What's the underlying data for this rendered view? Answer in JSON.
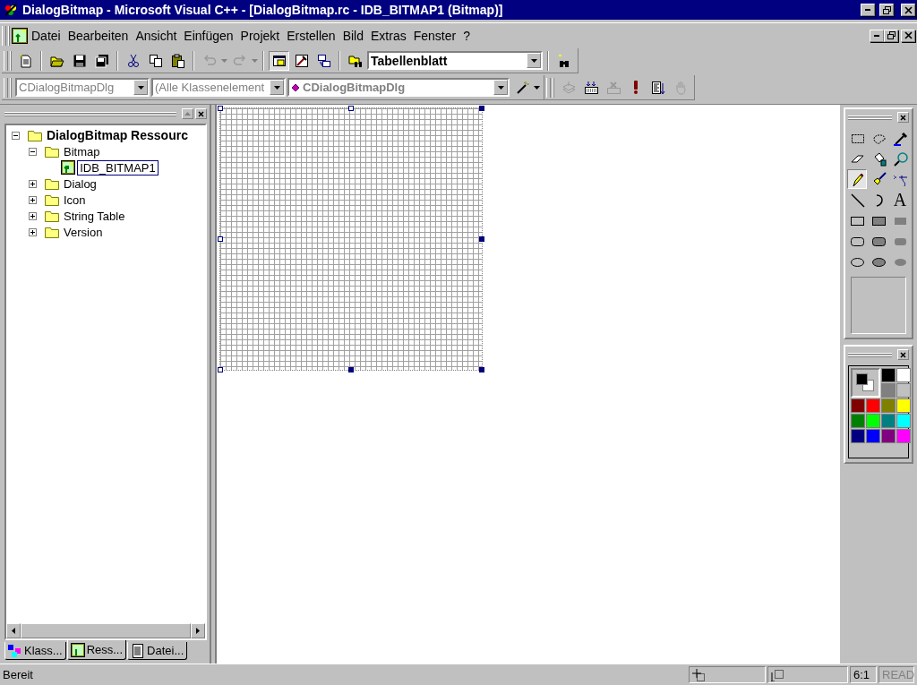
{
  "window": {
    "title": "DialogBitmap - Microsoft Visual C++ - [DialogBitmap.rc - IDB_BITMAP1 (Bitmap)]"
  },
  "menu": [
    "Datei",
    "Bearbeiten",
    "Ansicht",
    "Einfügen",
    "Projekt",
    "Erstellen",
    "Bild",
    "Extras",
    "Fenster",
    "?"
  ],
  "toolbar_main": [
    {
      "kind": "new-text",
      "disabled": false
    },
    {
      "kind": "separator"
    },
    {
      "kind": "open",
      "disabled": false
    },
    {
      "kind": "save",
      "disabled": false
    },
    {
      "kind": "save-all",
      "disabled": false
    },
    {
      "kind": "separator"
    },
    {
      "kind": "cut",
      "disabled": false
    },
    {
      "kind": "copy",
      "disabled": false
    },
    {
      "kind": "paste",
      "disabled": false
    },
    {
      "kind": "separator"
    },
    {
      "kind": "undo",
      "disabled": true
    },
    {
      "kind": "redo",
      "disabled": true
    },
    {
      "kind": "separator"
    },
    {
      "kind": "workspace",
      "disabled": false,
      "pressed": true
    },
    {
      "kind": "output",
      "disabled": false,
      "pressed": false
    },
    {
      "kind": "windows",
      "disabled": false,
      "pressed": false
    },
    {
      "kind": "separator"
    },
    {
      "kind": "find-files",
      "disabled": false
    },
    {
      "kind": "combo",
      "value": "Tabellenblatt",
      "disabled": false
    },
    {
      "kind": "separator"
    },
    {
      "kind": "search",
      "disabled": false
    }
  ],
  "toolbar_wizard": [
    {
      "kind": "combo",
      "value": "CDialogBitmapDlg",
      "disabled": true
    },
    {
      "kind": "combo",
      "value": "(Alle Klassenelement",
      "disabled": true
    },
    {
      "kind": "combo-member",
      "value": "CDialogBitmapDlg",
      "disabled": true
    },
    {
      "kind": "wand",
      "disabled": false
    }
  ],
  "toolbar_build": [
    {
      "kind": "compile",
      "disabled": true
    },
    {
      "kind": "build",
      "disabled": false
    },
    {
      "kind": "stop",
      "disabled": true
    },
    {
      "kind": "execute",
      "disabled": false
    },
    {
      "kind": "go",
      "disabled": false
    },
    {
      "kind": "hand",
      "disabled": true
    }
  ],
  "workspace": {
    "tree": [
      {
        "label": "DialogBitmap Ressourc",
        "kind": "root",
        "expanded": true,
        "selected": false,
        "children": [
          {
            "label": "Bitmap",
            "kind": "folder",
            "expanded": true,
            "selected": false,
            "children": [
              {
                "label": "IDB_BITMAP1",
                "kind": "bitmap",
                "selected": true
              }
            ]
          },
          {
            "label": "Dialog",
            "kind": "folder",
            "expanded": false,
            "selected": false
          },
          {
            "label": "Icon",
            "kind": "folder",
            "expanded": false,
            "selected": false
          },
          {
            "label": "String Table",
            "kind": "folder",
            "expanded": false,
            "selected": false
          },
          {
            "label": "Version",
            "kind": "folder",
            "expanded": false,
            "selected": false
          }
        ]
      }
    ],
    "tabs": [
      {
        "label": "Klass...",
        "kind": "classes",
        "selected": false
      },
      {
        "label": "Ress...",
        "kind": "resources",
        "selected": true
      },
      {
        "label": "Datei...",
        "kind": "files",
        "selected": false
      }
    ]
  },
  "tools": [
    {
      "kind": "select-rect",
      "selected": false
    },
    {
      "kind": "select-free",
      "selected": false
    },
    {
      "kind": "picker",
      "selected": false
    },
    {
      "kind": "eraser",
      "selected": false
    },
    {
      "kind": "fill",
      "selected": false
    },
    {
      "kind": "magnifier",
      "selected": false
    },
    {
      "kind": "pencil",
      "selected": true
    },
    {
      "kind": "brush",
      "selected": false
    },
    {
      "kind": "airbrush",
      "selected": false
    },
    {
      "kind": "line",
      "selected": false
    },
    {
      "kind": "curve",
      "selected": false
    },
    {
      "kind": "text",
      "label": "A",
      "selected": false
    },
    {
      "kind": "rect-outline",
      "selected": false
    },
    {
      "kind": "rect-both",
      "selected": false
    },
    {
      "kind": "rect-fill",
      "selected": false
    },
    {
      "kind": "round-outline",
      "selected": false
    },
    {
      "kind": "round-both",
      "selected": false
    },
    {
      "kind": "round-fill",
      "selected": false
    },
    {
      "kind": "ellipse-outline",
      "selected": false
    },
    {
      "kind": "ellipse-both",
      "selected": false
    },
    {
      "kind": "ellipse-fill",
      "selected": false
    }
  ],
  "colors": {
    "swatches": [
      {
        "color": "#000000"
      },
      {
        "color": "#ffffff"
      },
      {
        "color": "#808080"
      },
      {
        "color": "#c0c0c0"
      },
      {
        "color": "#800000"
      },
      {
        "color": "#ff0000"
      },
      {
        "color": "#808000"
      },
      {
        "color": "#ffff00"
      },
      {
        "color": "#008000"
      },
      {
        "color": "#00ff00"
      },
      {
        "color": "#008080"
      },
      {
        "color": "#00ffff"
      },
      {
        "color": "#000080"
      },
      {
        "color": "#0000ff"
      },
      {
        "color": "#800080"
      },
      {
        "color": "#ff00ff"
      }
    ]
  },
  "status_bar": {
    "text": "Bereit",
    "zoom": "6:1",
    "read": {
      "label": "READ",
      "disabled": true
    }
  }
}
